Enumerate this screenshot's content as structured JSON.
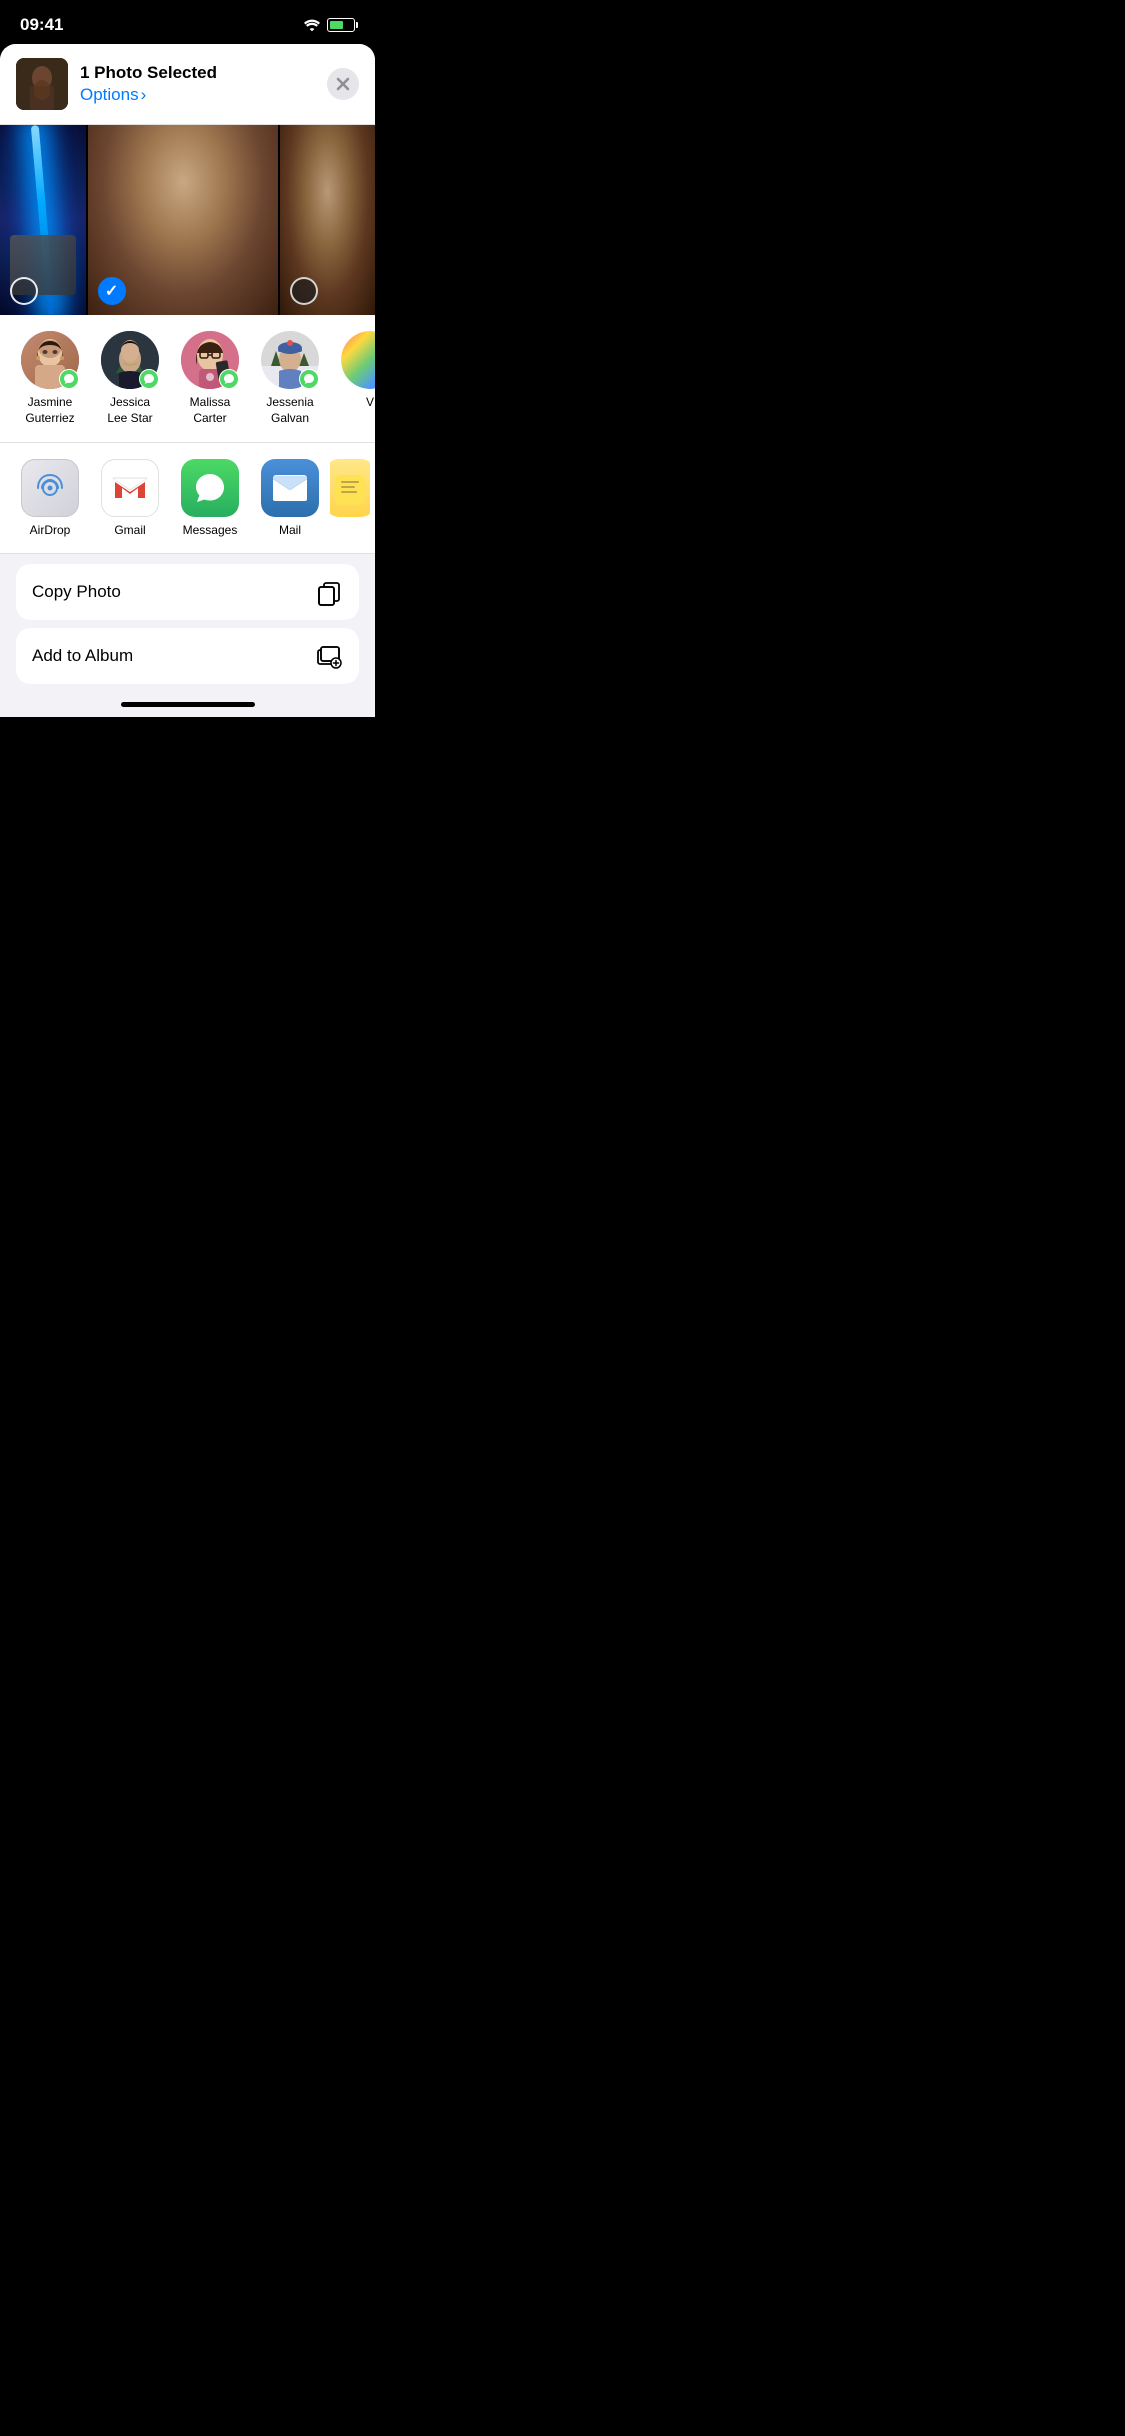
{
  "statusBar": {
    "time": "09:41",
    "wifi": true,
    "battery": 60
  },
  "shareHeader": {
    "title": "1 Photo Selected",
    "options": "Options",
    "chevron": "›",
    "closeLabel": "×"
  },
  "photos": [
    {
      "id": "lightsaber",
      "type": "lightsaber",
      "selected": false,
      "selectionType": "empty"
    },
    {
      "id": "man-center",
      "type": "man-center",
      "selected": true,
      "selectionType": "selected"
    },
    {
      "id": "man-right",
      "type": "man-right",
      "selected": false,
      "selectionType": "dark"
    }
  ],
  "contacts": [
    {
      "id": "jasmine",
      "name": "Jasmine\nGuterriez",
      "nameDisplay": "Jasmine Guterriez",
      "nameLine1": "Jasmine",
      "nameLine2": "Guterriez",
      "avatarClass": "avatar-jasmine",
      "emoji": "👩"
    },
    {
      "id": "jessica",
      "name": "Jessica Lee Star",
      "nameLine1": "Jessica",
      "nameLine2": "Lee Star",
      "avatarClass": "avatar-jessica",
      "emoji": "👩"
    },
    {
      "id": "malissa",
      "name": "Malissa Carter",
      "nameLine1": "Malissa",
      "nameLine2": "Carter",
      "avatarClass": "avatar-malissa",
      "emoji": "🤳"
    },
    {
      "id": "jessenia",
      "name": "Jessenia Galvan",
      "nameLine1": "Jessenia",
      "nameLine2": "Galvan",
      "avatarClass": "avatar-jessenia",
      "emoji": "🏔️"
    },
    {
      "id": "v",
      "name": "V",
      "nameLine1": "V",
      "nameLine2": "",
      "avatarClass": "avatar-v",
      "emoji": ""
    }
  ],
  "apps": [
    {
      "id": "airdrop",
      "name": "AirDrop",
      "iconClass": "app-airdrop",
      "iconType": "airdrop"
    },
    {
      "id": "gmail",
      "name": "Gmail",
      "iconClass": "app-gmail",
      "iconType": "gmail"
    },
    {
      "id": "messages",
      "name": "Messages",
      "iconClass": "app-messages",
      "iconType": "messages"
    },
    {
      "id": "mail",
      "name": "Mail",
      "iconClass": "app-mail",
      "iconType": "mail"
    },
    {
      "id": "notes",
      "name": "Notes",
      "iconClass": "app-notes",
      "iconType": "notes"
    }
  ],
  "actions": [
    {
      "id": "copy-photo",
      "label": "Copy Photo",
      "iconType": "copy"
    },
    {
      "id": "add-to-album",
      "label": "Add to Album",
      "iconType": "add-album"
    }
  ]
}
